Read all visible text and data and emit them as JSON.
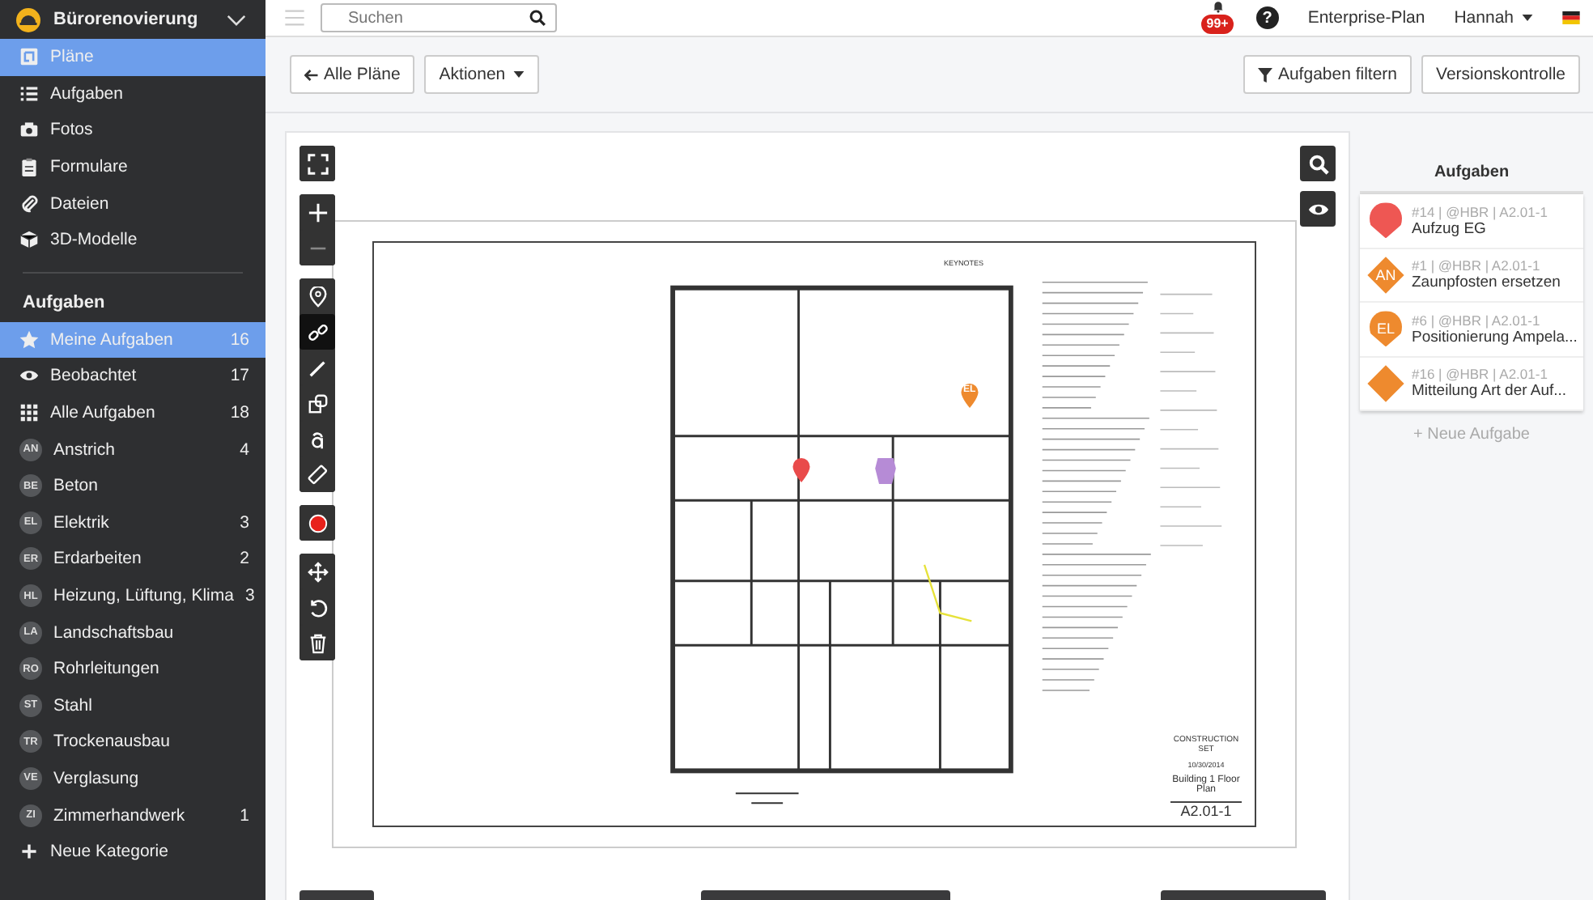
{
  "project": {
    "name": "Bürorenovierung"
  },
  "nav": [
    {
      "label": "Pläne",
      "selected": true
    },
    {
      "label": "Aufgaben",
      "selected": false
    },
    {
      "label": "Fotos",
      "selected": false
    },
    {
      "label": "Formulare",
      "selected": false
    },
    {
      "label": "Dateien",
      "selected": false
    },
    {
      "label": "3D-Modelle",
      "selected": false
    }
  ],
  "tasks_heading": "Aufgaben",
  "task_filters": [
    {
      "label": "Meine Aufgaben",
      "count": "16",
      "selected": true
    },
    {
      "label": "Beobachtet",
      "count": "17",
      "selected": false
    },
    {
      "label": "Alle Aufgaben",
      "count": "18",
      "selected": false
    }
  ],
  "categories": [
    {
      "code": "AN",
      "label": "Anstrich",
      "count": "4"
    },
    {
      "code": "BE",
      "label": "Beton"
    },
    {
      "code": "EL",
      "label": "Elektrik",
      "count": "3"
    },
    {
      "code": "ER",
      "label": "Erdarbeiten",
      "count": "2"
    },
    {
      "code": "HL",
      "label": "Heizung, Lüftung, Klima",
      "count": "3"
    },
    {
      "code": "LA",
      "label": "Landschaftsbau"
    },
    {
      "code": "RO",
      "label": "Rohrleitungen"
    },
    {
      "code": "ST",
      "label": "Stahl"
    },
    {
      "code": "TR",
      "label": "Trockenausbau"
    },
    {
      "code": "VE",
      "label": "Verglasung"
    },
    {
      "code": "ZI",
      "label": "Zimmerhandwerk",
      "count": "1"
    }
  ],
  "new_category": "Neue Kategorie",
  "topbar": {
    "search_placeholder": "Suchen",
    "notifications": "99+",
    "help": "?",
    "plan": "Enterprise-Plan",
    "user": "Hannah"
  },
  "actions": {
    "back": "Alle Pläne",
    "menu": "Aktionen",
    "filter": "Aufgaben filtern",
    "versions": "Versionskontrolle"
  },
  "tools": [
    {
      "kind": "fullscreen",
      "selected": false
    },
    {
      "kind": "zoom-in",
      "selected": false
    },
    {
      "kind": "zoom-out",
      "selected": false
    },
    {
      "kind": "pin",
      "selected": false
    },
    {
      "kind": "link",
      "selected": true
    },
    {
      "kind": "pen",
      "selected": false
    },
    {
      "kind": "shapes",
      "selected": false
    },
    {
      "kind": "text",
      "selected": false
    },
    {
      "kind": "ruler",
      "selected": false
    },
    {
      "kind": "record",
      "selected": false
    },
    {
      "kind": "move",
      "selected": false
    },
    {
      "kind": "rotate",
      "selected": false
    },
    {
      "kind": "trash",
      "selected": false
    }
  ],
  "sheet": {
    "keynotes": "KEYNOTES",
    "set_title": "CONSTRUCTION SET",
    "date": "10/30/2014",
    "drawing_title": "Building 1 Floor Plan",
    "number": "A2.01-1"
  },
  "plan_markers": [
    {
      "kind": "pin",
      "color": "#e94b4b"
    },
    {
      "kind": "pin",
      "color": "#ee8a2e",
      "code": "EL"
    },
    {
      "kind": "area",
      "color": "#b68bd6"
    }
  ],
  "panel": {
    "title": "Aufgaben",
    "new_task": "+ Neue Aufgabe"
  },
  "panel_tasks": [
    {
      "kind": "pin",
      "color": "#ee5753",
      "meta": "#14 | @HBR | A2.01-1",
      "title": "Aufzug EG"
    },
    {
      "kind": "diamond",
      "color": "#ee8a2e",
      "code": "AN",
      "meta": "#1 | @HBR | A2.01-1",
      "title": "Zaunpfosten ersetzen"
    },
    {
      "kind": "pin",
      "color": "#ee8a2e",
      "code": "EL",
      "meta": "#6 | @HBR | A2.01-1",
      "title": "Positionierung Ampela..."
    },
    {
      "kind": "diamond",
      "color": "#ee8a2e",
      "meta": "#16 | @HBR | A2.01-1",
      "title": "Mitteilung Art der Auf..."
    }
  ]
}
